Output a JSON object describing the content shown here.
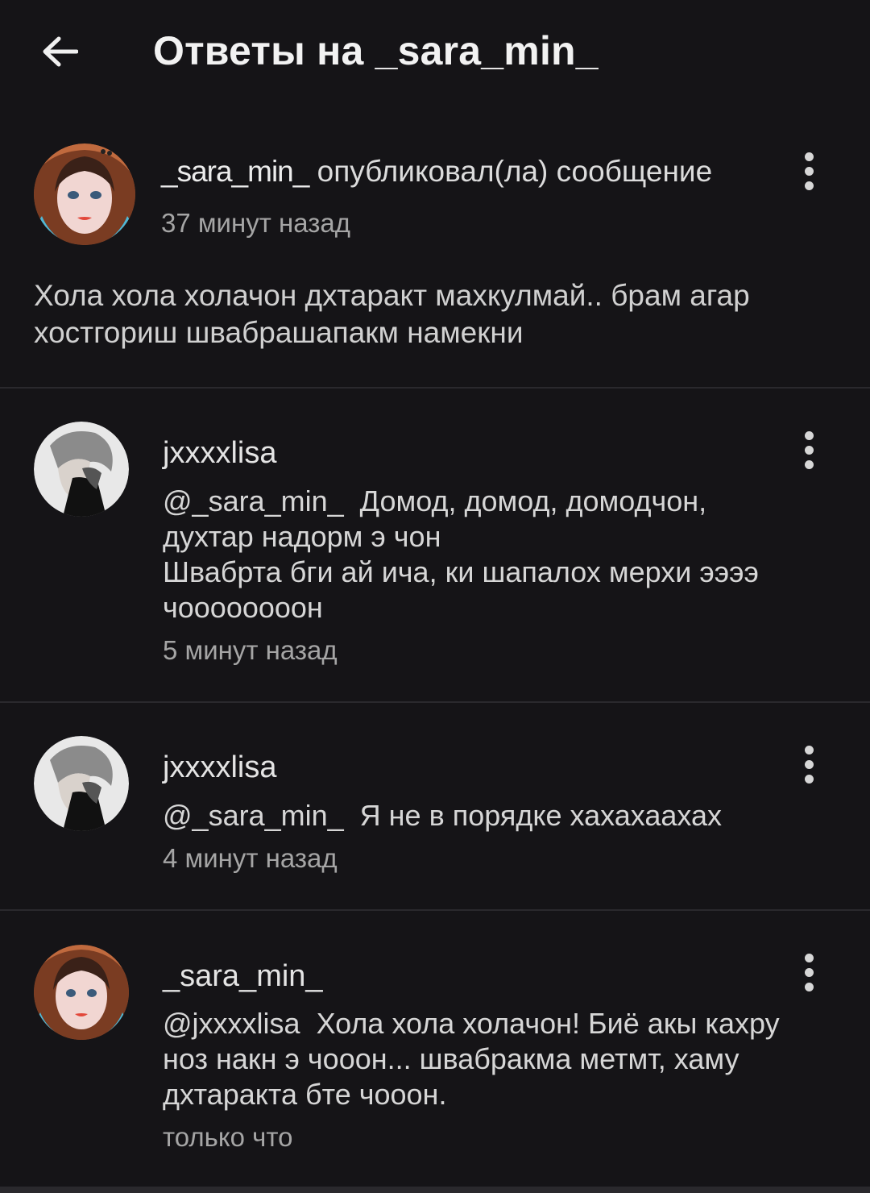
{
  "header": {
    "title": "Ответы на _sara_min_"
  },
  "post": {
    "username": "_sara_min_",
    "action": "опубликовал(ла) сообщение",
    "time": "37 минут назад",
    "body": "Хола хола холачон дхтаракт махкулмай.. брам агар хостгориш швабрашапакм намекни"
  },
  "replies": [
    {
      "username": "jxxxxlisa",
      "mention": "@_sara_min_",
      "text": "Домод, домод, домодчон,\nдухтар надорм э чон\nШвабрта бги ай ича, ки шапалох мерхи ээээ чоооооооон",
      "time": "5 минут назад"
    },
    {
      "username": "jxxxxlisa",
      "mention": "@_sara_min_",
      "text": "Я не в порядке хахахаахах",
      "time": "4 минут назад"
    },
    {
      "username": "_sara_min_",
      "mention": "@jxxxxlisa",
      "text": "Хола хола холачон! Биё акы кахру ноз накн э чооон... швабракма метмт, хаму дхтаракта бте чооон.",
      "time": "только что"
    }
  ]
}
